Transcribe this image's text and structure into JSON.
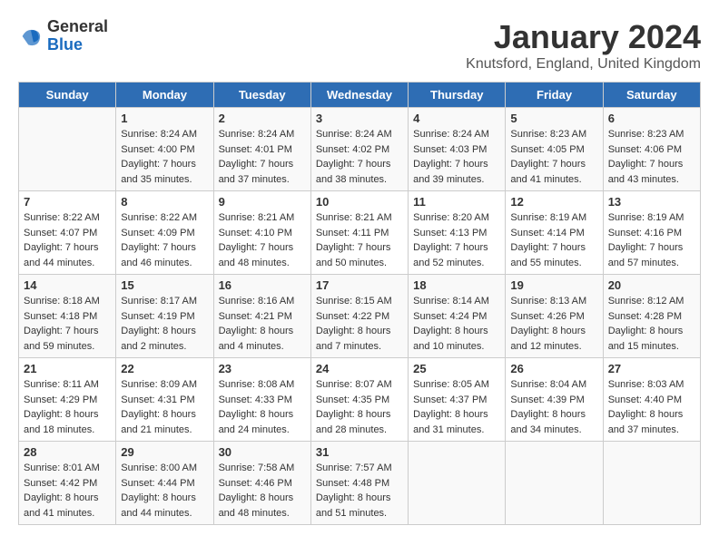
{
  "logo": {
    "general": "General",
    "blue": "Blue"
  },
  "title": "January 2024",
  "subtitle": "Knutsford, England, United Kingdom",
  "days_of_week": [
    "Sunday",
    "Monday",
    "Tuesday",
    "Wednesday",
    "Thursday",
    "Friday",
    "Saturday"
  ],
  "weeks": [
    [
      {
        "day": "",
        "info": ""
      },
      {
        "day": "1",
        "info": "Sunrise: 8:24 AM\nSunset: 4:00 PM\nDaylight: 7 hours\nand 35 minutes."
      },
      {
        "day": "2",
        "info": "Sunrise: 8:24 AM\nSunset: 4:01 PM\nDaylight: 7 hours\nand 37 minutes."
      },
      {
        "day": "3",
        "info": "Sunrise: 8:24 AM\nSunset: 4:02 PM\nDaylight: 7 hours\nand 38 minutes."
      },
      {
        "day": "4",
        "info": "Sunrise: 8:24 AM\nSunset: 4:03 PM\nDaylight: 7 hours\nand 39 minutes."
      },
      {
        "day": "5",
        "info": "Sunrise: 8:23 AM\nSunset: 4:05 PM\nDaylight: 7 hours\nand 41 minutes."
      },
      {
        "day": "6",
        "info": "Sunrise: 8:23 AM\nSunset: 4:06 PM\nDaylight: 7 hours\nand 43 minutes."
      }
    ],
    [
      {
        "day": "7",
        "info": "Sunrise: 8:22 AM\nSunset: 4:07 PM\nDaylight: 7 hours\nand 44 minutes."
      },
      {
        "day": "8",
        "info": "Sunrise: 8:22 AM\nSunset: 4:09 PM\nDaylight: 7 hours\nand 46 minutes."
      },
      {
        "day": "9",
        "info": "Sunrise: 8:21 AM\nSunset: 4:10 PM\nDaylight: 7 hours\nand 48 minutes."
      },
      {
        "day": "10",
        "info": "Sunrise: 8:21 AM\nSunset: 4:11 PM\nDaylight: 7 hours\nand 50 minutes."
      },
      {
        "day": "11",
        "info": "Sunrise: 8:20 AM\nSunset: 4:13 PM\nDaylight: 7 hours\nand 52 minutes."
      },
      {
        "day": "12",
        "info": "Sunrise: 8:19 AM\nSunset: 4:14 PM\nDaylight: 7 hours\nand 55 minutes."
      },
      {
        "day": "13",
        "info": "Sunrise: 8:19 AM\nSunset: 4:16 PM\nDaylight: 7 hours\nand 57 minutes."
      }
    ],
    [
      {
        "day": "14",
        "info": "Sunrise: 8:18 AM\nSunset: 4:18 PM\nDaylight: 7 hours\nand 59 minutes."
      },
      {
        "day": "15",
        "info": "Sunrise: 8:17 AM\nSunset: 4:19 PM\nDaylight: 8 hours\nand 2 minutes."
      },
      {
        "day": "16",
        "info": "Sunrise: 8:16 AM\nSunset: 4:21 PM\nDaylight: 8 hours\nand 4 minutes."
      },
      {
        "day": "17",
        "info": "Sunrise: 8:15 AM\nSunset: 4:22 PM\nDaylight: 8 hours\nand 7 minutes."
      },
      {
        "day": "18",
        "info": "Sunrise: 8:14 AM\nSunset: 4:24 PM\nDaylight: 8 hours\nand 10 minutes."
      },
      {
        "day": "19",
        "info": "Sunrise: 8:13 AM\nSunset: 4:26 PM\nDaylight: 8 hours\nand 12 minutes."
      },
      {
        "day": "20",
        "info": "Sunrise: 8:12 AM\nSunset: 4:28 PM\nDaylight: 8 hours\nand 15 minutes."
      }
    ],
    [
      {
        "day": "21",
        "info": "Sunrise: 8:11 AM\nSunset: 4:29 PM\nDaylight: 8 hours\nand 18 minutes."
      },
      {
        "day": "22",
        "info": "Sunrise: 8:09 AM\nSunset: 4:31 PM\nDaylight: 8 hours\nand 21 minutes."
      },
      {
        "day": "23",
        "info": "Sunrise: 8:08 AM\nSunset: 4:33 PM\nDaylight: 8 hours\nand 24 minutes."
      },
      {
        "day": "24",
        "info": "Sunrise: 8:07 AM\nSunset: 4:35 PM\nDaylight: 8 hours\nand 28 minutes."
      },
      {
        "day": "25",
        "info": "Sunrise: 8:05 AM\nSunset: 4:37 PM\nDaylight: 8 hours\nand 31 minutes."
      },
      {
        "day": "26",
        "info": "Sunrise: 8:04 AM\nSunset: 4:39 PM\nDaylight: 8 hours\nand 34 minutes."
      },
      {
        "day": "27",
        "info": "Sunrise: 8:03 AM\nSunset: 4:40 PM\nDaylight: 8 hours\nand 37 minutes."
      }
    ],
    [
      {
        "day": "28",
        "info": "Sunrise: 8:01 AM\nSunset: 4:42 PM\nDaylight: 8 hours\nand 41 minutes."
      },
      {
        "day": "29",
        "info": "Sunrise: 8:00 AM\nSunset: 4:44 PM\nDaylight: 8 hours\nand 44 minutes."
      },
      {
        "day": "30",
        "info": "Sunrise: 7:58 AM\nSunset: 4:46 PM\nDaylight: 8 hours\nand 48 minutes."
      },
      {
        "day": "31",
        "info": "Sunrise: 7:57 AM\nSunset: 4:48 PM\nDaylight: 8 hours\nand 51 minutes."
      },
      {
        "day": "",
        "info": ""
      },
      {
        "day": "",
        "info": ""
      },
      {
        "day": "",
        "info": ""
      }
    ]
  ]
}
